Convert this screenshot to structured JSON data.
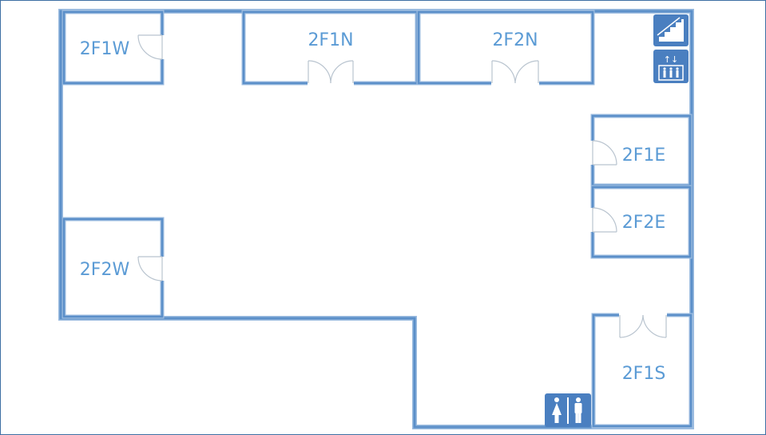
{
  "floor": "2F",
  "colors": {
    "wall": "#5b8fc9",
    "wall_outline": "#9cbce0",
    "door": "#b9c4cf",
    "label": "#5b9bd5",
    "icon_bg": "#4a7fc0",
    "frame": "#3e6fa3"
  },
  "rooms": {
    "r2f1w": "2F1W",
    "r2f1n": "2F1N",
    "r2f2n": "2F2N",
    "r2f1e": "2F1E",
    "r2f2e": "2F2E",
    "r2f2w": "2F2W",
    "r2f1s": "2F1S"
  },
  "icons": {
    "stairs": "stairs-icon",
    "elevator": "elevator-icon",
    "restroom": "restroom-icon"
  },
  "elevator_arrows": "↑↓"
}
